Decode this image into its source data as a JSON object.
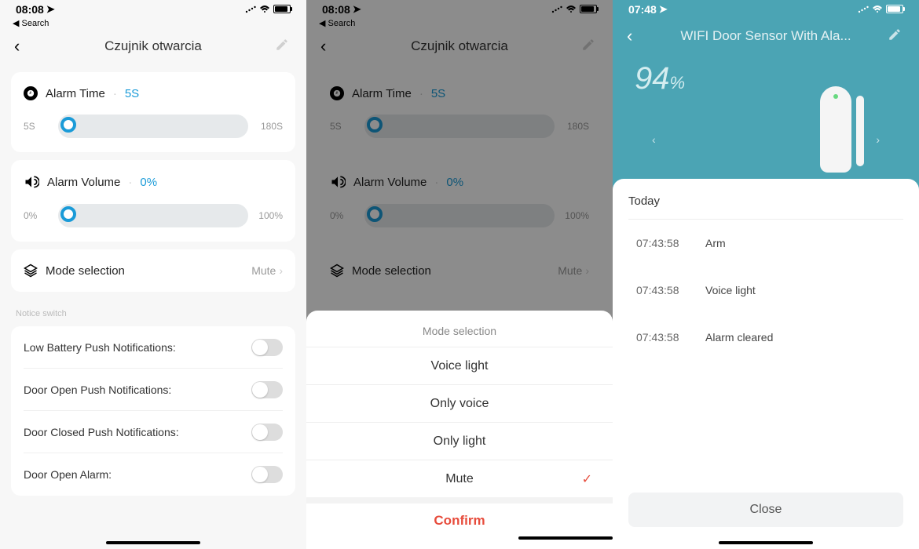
{
  "screen1": {
    "status_time": "08:08",
    "search_back_label": "Search",
    "header_title": "Czujnik otwarcia",
    "alarm_time": {
      "label": "Alarm Time",
      "value": "5S",
      "slider_min": "5S",
      "slider_max": "180S"
    },
    "alarm_volume": {
      "label": "Alarm Volume",
      "value": "0%",
      "slider_min": "0%",
      "slider_max": "100%"
    },
    "mode_selection": {
      "label": "Mode selection",
      "value": "Mute"
    },
    "notice_section_title": "Notice switch",
    "notices": [
      {
        "label": "Low Battery Push Notifications:",
        "on": false
      },
      {
        "label": "Door Open Push Notifications:",
        "on": false
      },
      {
        "label": "Door Closed Push Notifications:",
        "on": false
      },
      {
        "label": "Door Open Alarm:",
        "on": false
      }
    ]
  },
  "screen2": {
    "status_time": "08:08",
    "search_back_label": "Search",
    "header_title": "Czujnik otwarcia",
    "alarm_time": {
      "label": "Alarm Time",
      "value": "5S",
      "slider_min": "5S",
      "slider_max": "180S"
    },
    "alarm_volume": {
      "label": "Alarm Volume",
      "value": "0%",
      "slider_min": "0%",
      "slider_max": "100%"
    },
    "mode_selection": {
      "label": "Mode selection",
      "value": "Mute"
    },
    "action_sheet": {
      "title": "Mode selection",
      "options": [
        "Voice light",
        "Only voice",
        "Only light",
        "Mute"
      ],
      "selected_index": 3,
      "confirm": "Confirm"
    }
  },
  "screen3": {
    "status_time": "07:48",
    "header_title": "WIFI Door Sensor With Ala...",
    "battery_pct": "94",
    "battery_unit": "%",
    "log_heading": "Today",
    "log": [
      {
        "time": "07:43:58",
        "event": "Arm"
      },
      {
        "time": "07:43:58",
        "event": "Voice light"
      },
      {
        "time": "07:43:58",
        "event": "Alarm cleared"
      }
    ],
    "close": "Close"
  }
}
